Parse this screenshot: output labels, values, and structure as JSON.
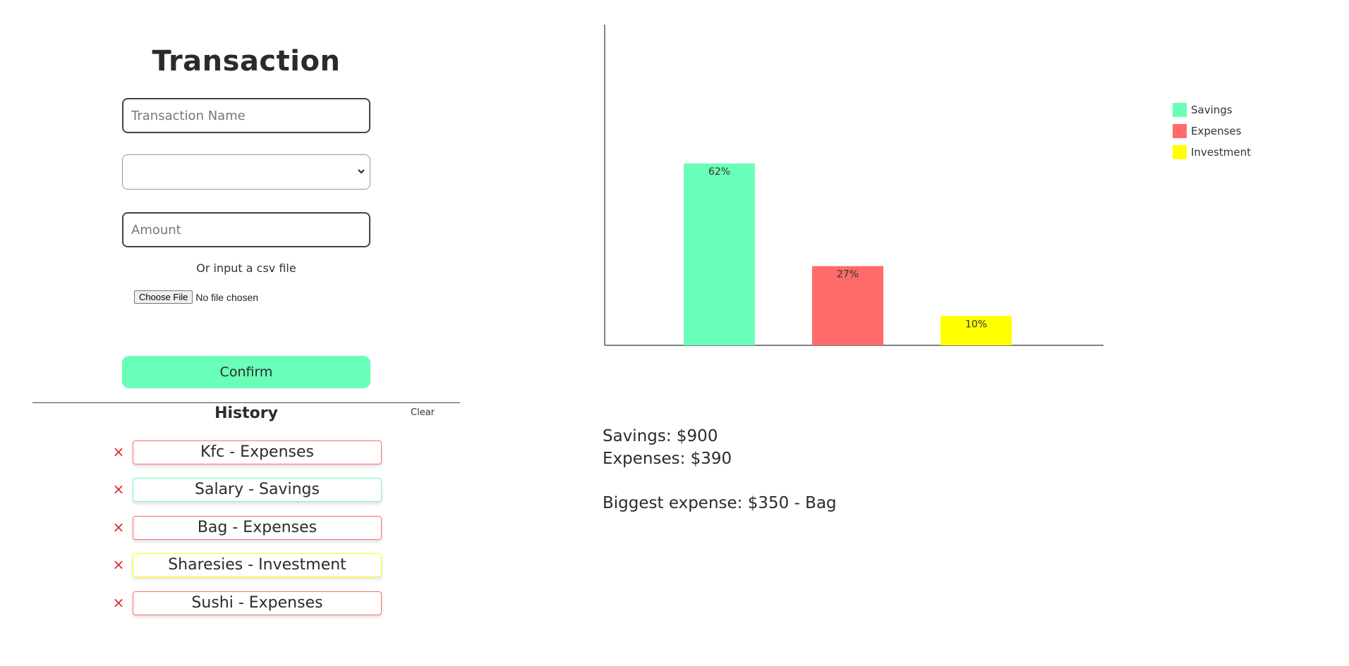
{
  "form": {
    "title": "Transaction",
    "name_placeholder": "Transaction Name",
    "category_value": "",
    "amount_placeholder": "Amount",
    "csv_label": "Or input a csv file",
    "file_button": "Choose File",
    "file_status": "No file chosen",
    "confirm_label": "Confirm"
  },
  "history": {
    "title": "History",
    "clear_label": "Clear",
    "remove_icon": "×",
    "items": [
      {
        "label": "Kfc - Expenses",
        "category": "Expenses"
      },
      {
        "label": "Salary - Savings",
        "category": "Savings"
      },
      {
        "label": "Bag - Expenses",
        "category": "Expenses"
      },
      {
        "label": "Sharesies - Investment",
        "category": "Investment"
      },
      {
        "label": "Sushi - Expenses",
        "category": "Expenses"
      }
    ]
  },
  "colors": {
    "Savings": "#6affb8",
    "Expenses": "#ff6b6b",
    "Investment": "#ffff00"
  },
  "chart_data": {
    "type": "bar",
    "categories": [
      "Savings",
      "Expenses",
      "Investment"
    ],
    "values": [
      62,
      27,
      10
    ],
    "data_labels": [
      "62%",
      "27%",
      "10%"
    ],
    "ylim": [
      0,
      100
    ],
    "legend_position": "right",
    "grid": false
  },
  "legend": {
    "items": [
      {
        "label": "Savings"
      },
      {
        "label": "Expenses"
      },
      {
        "label": "Investment"
      }
    ]
  },
  "summary": {
    "savings": "Savings: $900",
    "expenses": "Expenses: $390",
    "biggest": "Biggest expense: $350 - Bag"
  }
}
